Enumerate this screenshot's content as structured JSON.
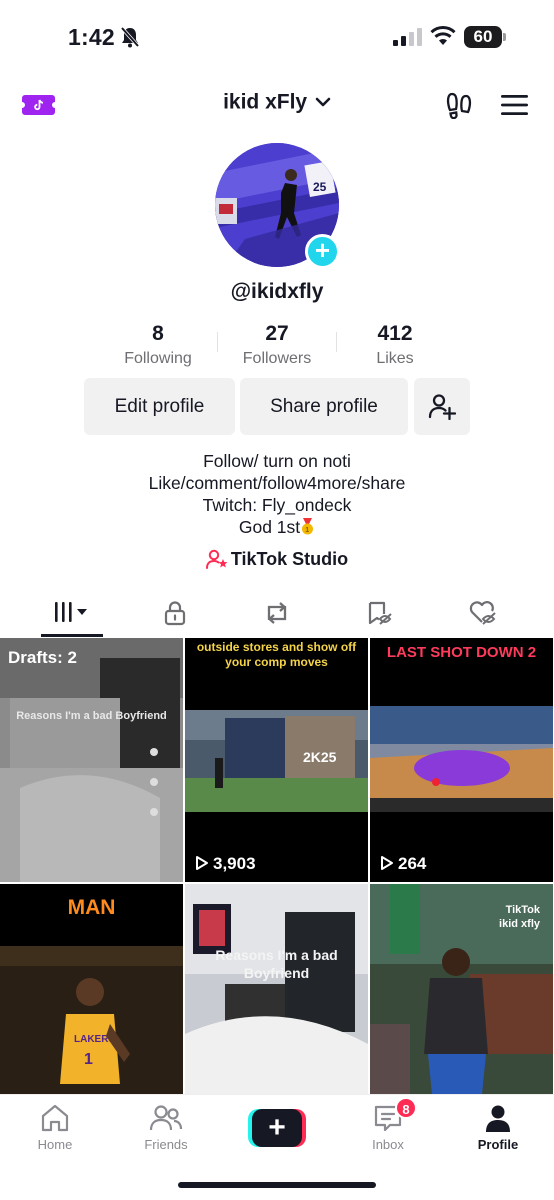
{
  "status_bar": {
    "time": "1:42",
    "battery_percent": "60",
    "battery_level": 0.6
  },
  "top_nav": {
    "title": "ikid xFly"
  },
  "profile": {
    "handle": "@ikidxfly",
    "stats": [
      {
        "value": "8",
        "label": "Following"
      },
      {
        "value": "27",
        "label": "Followers"
      },
      {
        "value": "412",
        "label": "Likes"
      }
    ],
    "buttons": {
      "edit": "Edit profile",
      "share": "Share profile"
    },
    "bio": [
      "Follow/ turn on noti",
      "Like/comment/follow4more/share",
      "Twitch: Fly_ondeck",
      "God 1st"
    ],
    "studio_link": "TikTok Studio"
  },
  "tabs": [
    {
      "icon": "videos-grid-icon",
      "active": true
    },
    {
      "icon": "lock-icon"
    },
    {
      "icon": "repost-icon"
    },
    {
      "icon": "favorites-icon"
    },
    {
      "icon": "liked-icon"
    }
  ],
  "videos": [
    {
      "drafts_label": "Drafts: 2",
      "overlay": "Reasons I'm a bad Boyfriend"
    },
    {
      "overlay": "outside stores and show off your comp moves",
      "views": "3,903"
    },
    {
      "overlay": "LAST SHOT DOWN 2",
      "views": "264"
    },
    {
      "overlay": "MAN"
    },
    {
      "overlay": "Reasons I'm a bad Boyfriend"
    },
    {
      "overlay": "TikTok",
      "overlay2": "ikid xfly"
    }
  ],
  "bottom_nav": {
    "home": "Home",
    "friends": "Friends",
    "create": "+",
    "inbox": "Inbox",
    "inbox_badge": "8",
    "profile": "Profile"
  },
  "colors": {
    "accent_pink": "#fe2c55",
    "accent_cyan": "#25f4ee",
    "ticket_purple": "#a024f0"
  }
}
